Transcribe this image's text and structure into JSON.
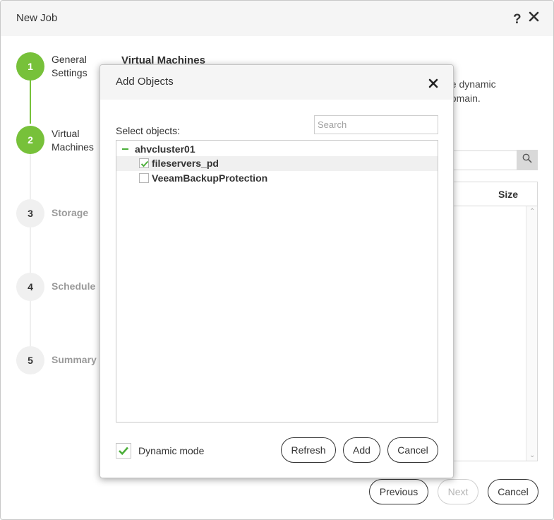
{
  "window": {
    "title": "New Job",
    "help_symbol": "?"
  },
  "steps": [
    {
      "number": "1",
      "label": "General Settings",
      "state": "done"
    },
    {
      "number": "2",
      "label": "Virtual Machines",
      "state": "current"
    },
    {
      "number": "3",
      "label": "Storage",
      "state": "pending"
    },
    {
      "number": "4",
      "label": "Schedule",
      "state": "pending"
    },
    {
      "number": "5",
      "label": "Summary",
      "state": "pending"
    }
  ],
  "content": {
    "title": "Virtual Machines",
    "description_fragment_1": "de dynamic",
    "description_fragment_2": "domain.",
    "table_size_header": "Size"
  },
  "footer": {
    "previous": "Previous",
    "next": "Next",
    "cancel": "Cancel"
  },
  "dialog": {
    "title": "Add Objects",
    "select_label": "Select objects:",
    "search_placeholder": "Search",
    "tree": {
      "root": "ahvcluster01",
      "items": [
        {
          "label": "fileservers_pd",
          "checked": true
        },
        {
          "label": "VeeamBackupProtection",
          "checked": false
        }
      ]
    },
    "dynamic_mode_label": "Dynamic mode",
    "dynamic_mode_checked": true,
    "refresh": "Refresh",
    "add": "Add",
    "cancel": "Cancel"
  },
  "colors": {
    "accent_green": "#77c13a",
    "check_green": "#4caf3a"
  }
}
